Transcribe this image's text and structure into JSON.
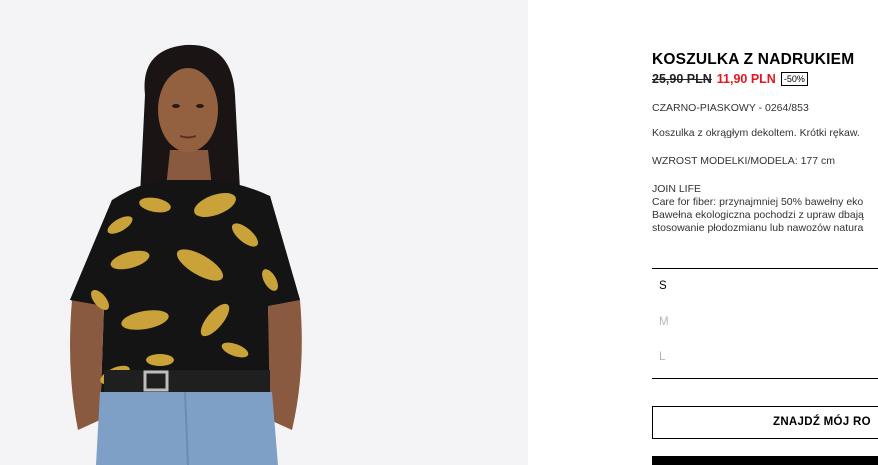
{
  "product": {
    "title": "KOSZULKA Z NADRUKIEM",
    "old_price": "25,90 PLN",
    "new_price": "11,90 PLN",
    "discount": "-50%",
    "color_ref": "CZARNO-PIASKOWY - 0264/853",
    "description": "Koszulka z okrągłym dekoltem. Krótki rękaw.",
    "model_height": "WZROST MODELKI/MODELA: 177 cm",
    "join_life": {
      "title": "JOIN LIFE",
      "line1": "Care for fiber: przynajmniej 50% bawełny eko",
      "line2": "Bawełna ekologiczna pochodzi z upraw dbają",
      "line3": "stosowanie płodozmianu lub nawozów natura"
    }
  },
  "sizes": [
    {
      "label": "S",
      "available": true
    },
    {
      "label": "M",
      "available": false
    },
    {
      "label": "L",
      "available": false
    }
  ],
  "buttons": {
    "find_size": "ZNAJDŹ MÓJ RO"
  },
  "colors": {
    "price_red": "#e4151c",
    "unavailable_gray": "#b5b5b5",
    "photo_bg": "#f4f4f6",
    "shirt_black": "#141414",
    "leopard_gold": "#c9a23a"
  },
  "icons": {
    "photo": "product-photo-model-leopard-tshirt"
  }
}
